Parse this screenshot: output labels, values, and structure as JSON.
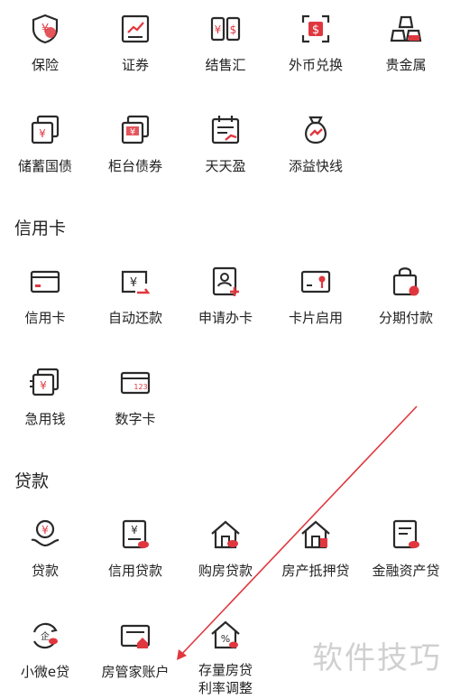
{
  "colors": {
    "icon_stroke": "#2a2a2a",
    "accent": "#e0373f",
    "watermark": "#9a9a9a"
  },
  "wealth": {
    "row1": [
      {
        "label": "保险",
        "icon": "shield-yuan-icon"
      },
      {
        "label": "证券",
        "icon": "stock-chart-icon"
      },
      {
        "label": "结售汇",
        "icon": "exchange-yuan-dollar-icon"
      },
      {
        "label": "外币兑换",
        "icon": "dollar-scan-icon"
      },
      {
        "label": "贵金属",
        "icon": "gold-bars-icon"
      }
    ],
    "row2": [
      {
        "label": "储蓄国债",
        "icon": "bond-stack-icon"
      },
      {
        "label": "柜台债券",
        "icon": "counter-bond-icon"
      },
      {
        "label": "天天盈",
        "icon": "calendar-growth-icon"
      },
      {
        "label": "添益快线",
        "icon": "money-bag-icon"
      }
    ]
  },
  "credit_card": {
    "title": "信用卡",
    "row1": [
      {
        "label": "信用卡",
        "icon": "credit-card-icon"
      },
      {
        "label": "自动还款",
        "icon": "auto-repay-icon"
      },
      {
        "label": "申请办卡",
        "icon": "apply-card-icon"
      },
      {
        "label": "卡片启用",
        "icon": "card-activate-icon"
      },
      {
        "label": "分期付款",
        "icon": "installment-bag-icon"
      }
    ],
    "row2": [
      {
        "label": "急用钱",
        "icon": "urgent-cash-icon"
      },
      {
        "label": "数字卡",
        "icon": "digital-card-icon"
      }
    ]
  },
  "loans": {
    "title": "贷款",
    "row1": [
      {
        "label": "贷款",
        "icon": "loan-hand-icon"
      },
      {
        "label": "信用贷款",
        "icon": "credit-loan-icon"
      },
      {
        "label": "购房贷款",
        "icon": "house-loan-icon"
      },
      {
        "label": "房产抵押贷",
        "icon": "house-mortgage-icon"
      },
      {
        "label": "金融资产贷",
        "icon": "financial-asset-loan-icon"
      }
    ],
    "row2": [
      {
        "label": "小微e贷",
        "icon": "micro-e-loan-icon"
      },
      {
        "label": "房管家账户",
        "icon": "house-steward-account-icon"
      },
      {
        "label": "存量房贷",
        "label2": "利率调整",
        "icon": "rate-adjust-house-icon"
      }
    ]
  },
  "watermark": "软件技巧"
}
